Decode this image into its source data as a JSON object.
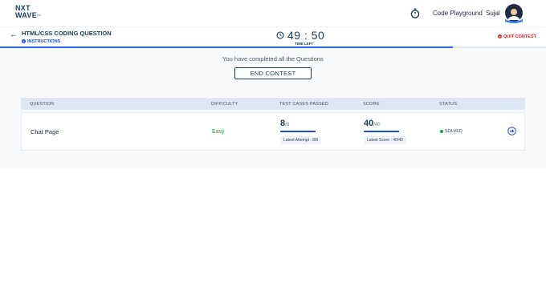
{
  "brand": {
    "line1": "NXT",
    "line2": "WAVE",
    "tm": "TM"
  },
  "nav": {
    "playground": "Code Playground",
    "user": "Sujal"
  },
  "header": {
    "title": "HTML/CSS CODING QUESTION",
    "instructions": "INSTRUCTIONS",
    "timer": "49 : 50",
    "time_left": "TIME LEFT",
    "quit": "QUIT CONTEST",
    "progress_fraction": 0.83
  },
  "main": {
    "completed_text": "You have completed all the Questions",
    "end_button": "END CONTEST"
  },
  "table": {
    "headers": [
      "QUESTION",
      "DIFFICULTY",
      "TEST CASES PASSED",
      "SCORE",
      "STATUS"
    ],
    "rows": [
      {
        "question": "Chat Page",
        "difficulty": "Easy",
        "passed": "8",
        "passed_total": "/8",
        "latest_attempt": "Latest Attempt : 8/8",
        "score": "40",
        "score_total": "/40",
        "latest_score": "Latest Score : 40/40",
        "status": "SOLVED"
      }
    ]
  },
  "colors": {
    "accent": "#1d4ed8",
    "navy": "#183b56",
    "success": "#16a34a",
    "danger": "#dc2626"
  }
}
